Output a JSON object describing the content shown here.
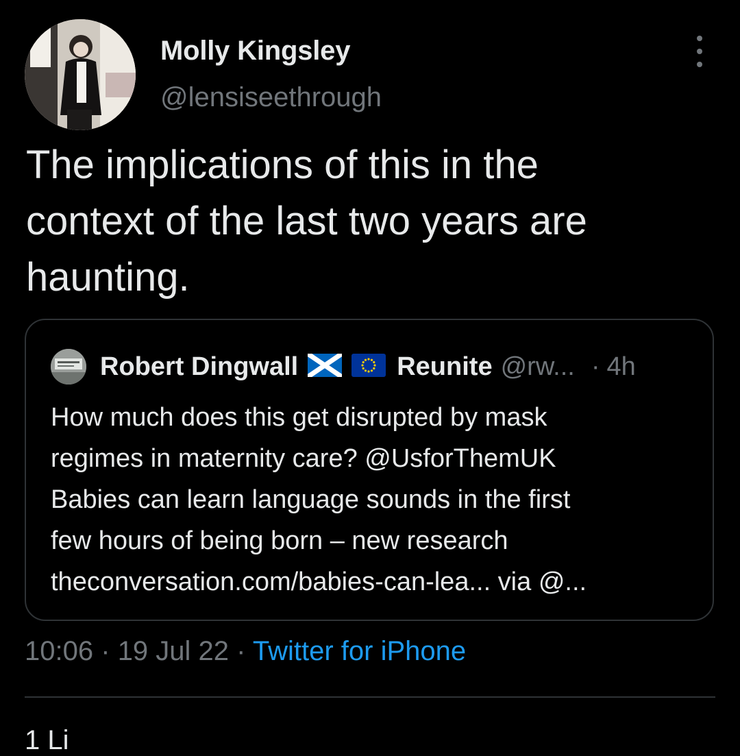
{
  "author": {
    "name": "Molly Kingsley",
    "handle": "@lensiseethrough"
  },
  "tweet": {
    "text_lines": [
      "The implications of this in the",
      "context of the last two years are",
      "haunting."
    ]
  },
  "quoted_tweet": {
    "name": "Robert Dingwall",
    "name_suffix": "Reunite",
    "handle": "@rw...",
    "separator": "·",
    "time": "4h",
    "flags": [
      "scotland-flag",
      "eu-flag"
    ],
    "text_lines": [
      "How much does this get disrupted by mask",
      "regimes in maternity care? @UsforThemUK",
      "Babies can learn language sounds in the first",
      "few hours of being born – new research",
      "theconversation.com/babies-can-lea... via @..."
    ]
  },
  "meta": {
    "time": "10:06",
    "date": "19 Jul 22",
    "separator": "·",
    "source": "Twitter for iPhone"
  },
  "stats": {
    "partial_text": "1 Li"
  },
  "icons": {
    "more": "more-vertical-icon"
  },
  "colors": {
    "background": "#000000",
    "text": "#e7e9ea",
    "secondary_text": "#71767b",
    "link": "#1d9bf0",
    "border": "#2f3336"
  }
}
